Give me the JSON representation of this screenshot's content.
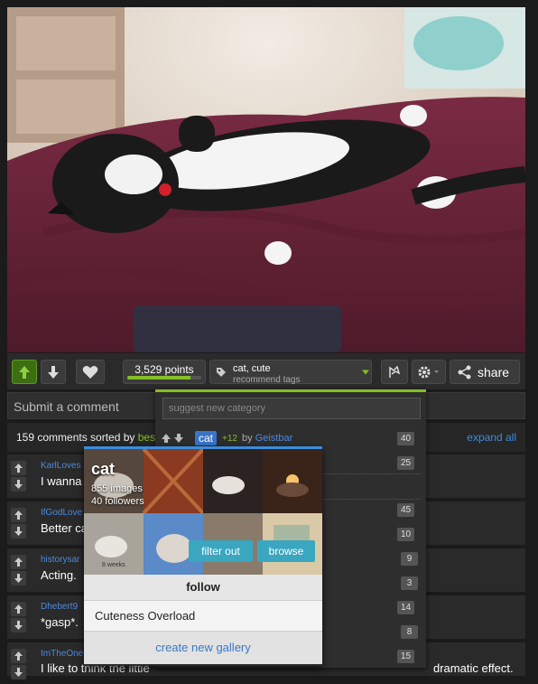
{
  "toolbar": {
    "points": "3,529 points",
    "points_fill": 0.85,
    "tags": "cat, cute",
    "tags_sub": "recommend tags",
    "share": "share"
  },
  "comment_input": {
    "placeholder": "Submit a comment"
  },
  "comments_header": {
    "count": "159 comments sorted by",
    "sort": "bes",
    "expand": "expand all"
  },
  "comments": [
    {
      "user": "KarlLoves",
      "text": "I wanna"
    },
    {
      "user": "IfGodLove",
      "text": "Better ca"
    },
    {
      "user": "historysar",
      "text": "Acting."
    },
    {
      "user": "Dhebert9",
      "text": "*gasp*."
    },
    {
      "user": "ImTheOne",
      "text": "I like to think the little",
      "text_end": "dramatic effect."
    }
  ],
  "tag_dropdown": {
    "placeholder": "suggest new category",
    "tag": "cat",
    "score": "+12",
    "by": "by",
    "user": "Geistbar",
    "scores": [
      "40",
      "25",
      "45",
      "10",
      "9",
      "3",
      "14",
      "8",
      "15"
    ]
  },
  "cat_popover": {
    "title": "cat",
    "images": "855 images",
    "followers": "40 followers",
    "thumb_caption": "8 weeks",
    "filter": "filter out",
    "browse": "browse",
    "follow": "follow",
    "gallery": "Cuteness Overload",
    "create": "create new gallery"
  },
  "colors": {
    "accent_green": "#85bf25",
    "link_blue": "#3a8dde",
    "chip_blue": "#3a74c8",
    "popover_button": "#3aa6c0"
  }
}
